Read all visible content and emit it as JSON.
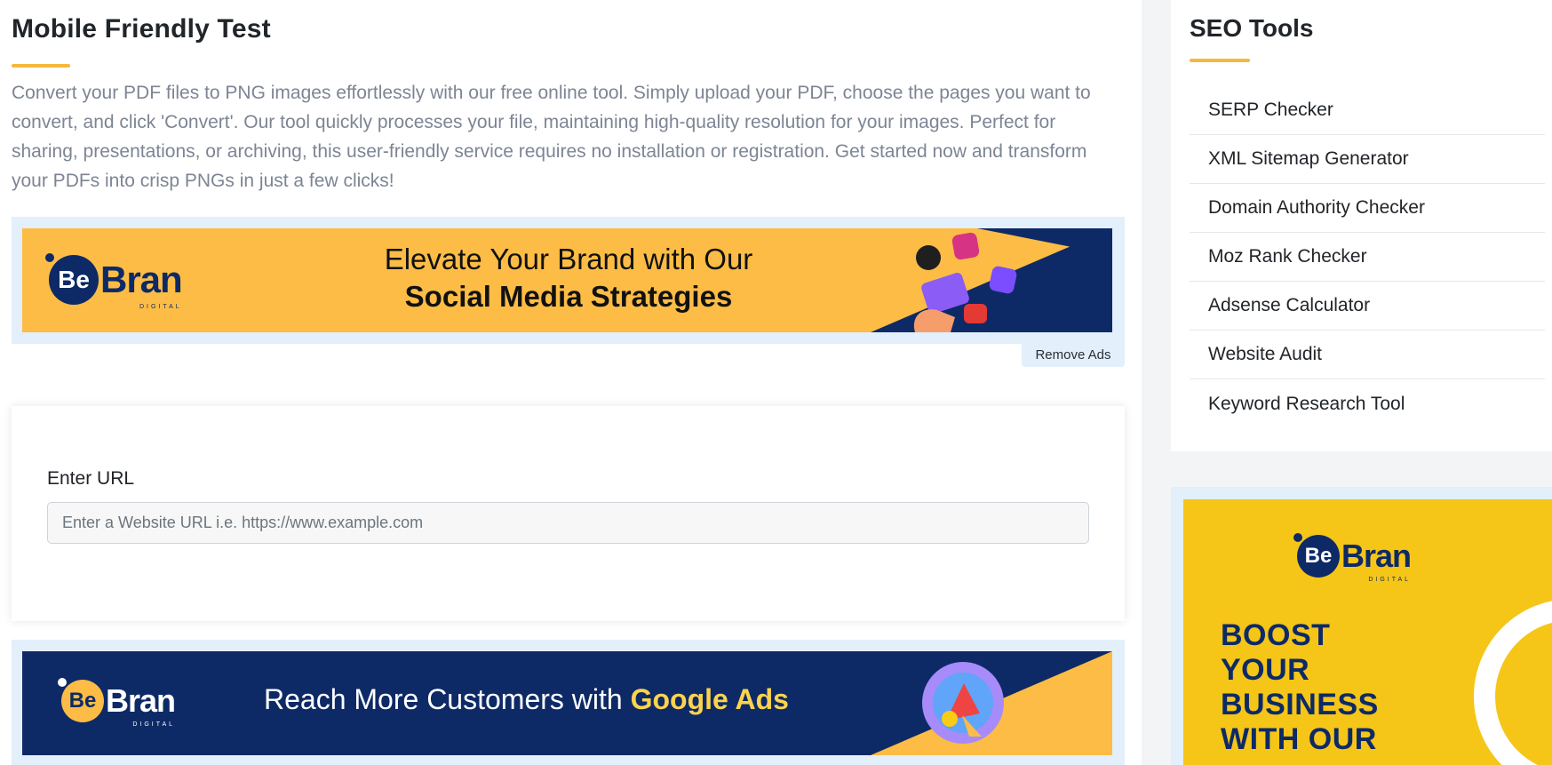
{
  "main": {
    "title": "Mobile Friendly Test",
    "description": "Convert your PDF files to PNG images effortlessly with our free online tool. Simply upload your PDF, choose the pages you want to convert, and click 'Convert'. Our tool quickly processes your file, maintaining high-quality resolution for your images. Perfect for sharing, presentations, or archiving, this user-friendly service requires no installation or registration. Get started now and transform your PDFs into crisp PNGs in just a few clicks!"
  },
  "ad_top": {
    "brand_be": "Be",
    "brand_rest": "Bran",
    "brand_sub": "DIGITAL",
    "line1": "Elevate Your Brand with Our",
    "line2": "Social Media Strategies"
  },
  "remove_ads": "Remove Ads",
  "url_form": {
    "label": "Enter URL",
    "placeholder": "Enter a Website URL i.e. https://www.example.com",
    "value": ""
  },
  "ad_bottom": {
    "brand_be": "Be",
    "brand_rest": "Bran",
    "brand_sub": "DIGITAL",
    "text_plain": "Reach More Customers with ",
    "text_highlight": "Google Ads"
  },
  "sidebar": {
    "title": "SEO Tools",
    "items": [
      {
        "label": "SERP Checker"
      },
      {
        "label": "XML Sitemap Generator"
      },
      {
        "label": "Domain Authority Checker"
      },
      {
        "label": "Moz Rank Checker"
      },
      {
        "label": "Adsense Calculator"
      },
      {
        "label": "Website Audit"
      },
      {
        "label": "Keyword Research Tool"
      }
    ]
  },
  "side_ad": {
    "brand_be": "Be",
    "brand_rest": "Bran",
    "brand_sub": "DIGITAL",
    "line1": "BOOST",
    "line2": "YOUR",
    "line3": "BUSINESS",
    "line4": "WITH OUR"
  },
  "colors": {
    "accent": "#f6b93b",
    "navy": "#0d2a66",
    "ad_yellow": "#fcbc45",
    "ad_frame": "#e3effb"
  }
}
